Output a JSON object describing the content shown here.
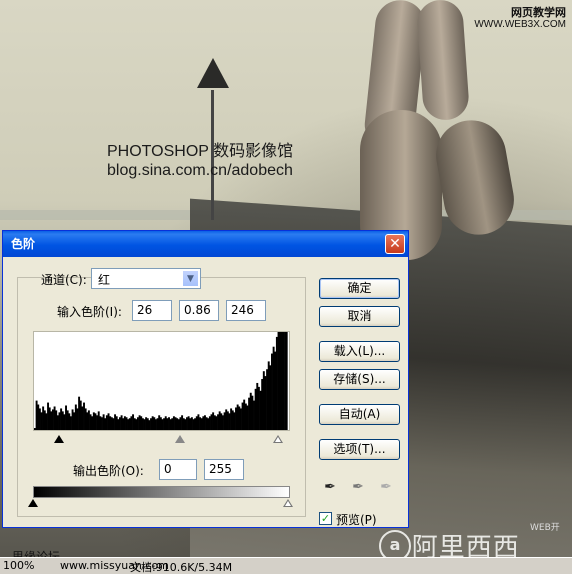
{
  "watermark": {
    "line1": "PHOTOSHOP 数码影像馆",
    "line2": "blog.sina.com.cn/adobech"
  },
  "corner_badge": {
    "line1": "网页教学网",
    "line2": "WWW.WEB3X.COM"
  },
  "dialog": {
    "title": "色阶",
    "close_glyph": "✕",
    "channel_label": "通道(C):",
    "channel_value": "红",
    "input_levels_label": "输入色阶(I):",
    "input_black": "26",
    "input_gamma": "0.86",
    "input_white": "246",
    "output_levels_label": "输出色阶(O):",
    "output_black": "0",
    "output_white": "255",
    "buttons": {
      "ok": "确定",
      "cancel": "取消",
      "load": "载入(L)...",
      "save": "存储(S)...",
      "auto": "自动(A)",
      "options": "选项(T)..."
    },
    "preview_label": "预览(P)",
    "preview_checked": true
  },
  "histogram": {
    "values": [
      2,
      30,
      26,
      22,
      18,
      24,
      20,
      17,
      28,
      23,
      19,
      21,
      24,
      20,
      15,
      18,
      22,
      19,
      16,
      25,
      20,
      17,
      14,
      21,
      18,
      26,
      22,
      34,
      30,
      24,
      28,
      22,
      18,
      20,
      16,
      14,
      18,
      17,
      15,
      19,
      14,
      13,
      16,
      12,
      15,
      17,
      14,
      13,
      12,
      16,
      14,
      11,
      13,
      15,
      12,
      14,
      13,
      11,
      12,
      14,
      16,
      12,
      11,
      13,
      15,
      14,
      12,
      11,
      13,
      12,
      10,
      12,
      14,
      13,
      11,
      12,
      15,
      13,
      11,
      12,
      14,
      12,
      13,
      11,
      12,
      14,
      13,
      12,
      11,
      13,
      15,
      12,
      11,
      13,
      14,
      12,
      13,
      11,
      12,
      14,
      16,
      13,
      12,
      14,
      15,
      13,
      12,
      14,
      16,
      18,
      15,
      14,
      16,
      19,
      17,
      15,
      18,
      21,
      19,
      17,
      22,
      20,
      18,
      23,
      26,
      24,
      22,
      28,
      31,
      27,
      25,
      33,
      38,
      35,
      30,
      42,
      48,
      44,
      40,
      52,
      60,
      55,
      62,
      70,
      66,
      78,
      85,
      80,
      95,
      100,
      100,
      100,
      100,
      100,
      100,
      0
    ]
  },
  "status": {
    "zoom": "100%",
    "doc_info": "文档:910.6K/5.34M",
    "forum": "思缘论坛",
    "site": "www.missyuan.com"
  },
  "brand": {
    "logo": "a",
    "text": "阿里西西",
    "webkai": "WEB开"
  }
}
